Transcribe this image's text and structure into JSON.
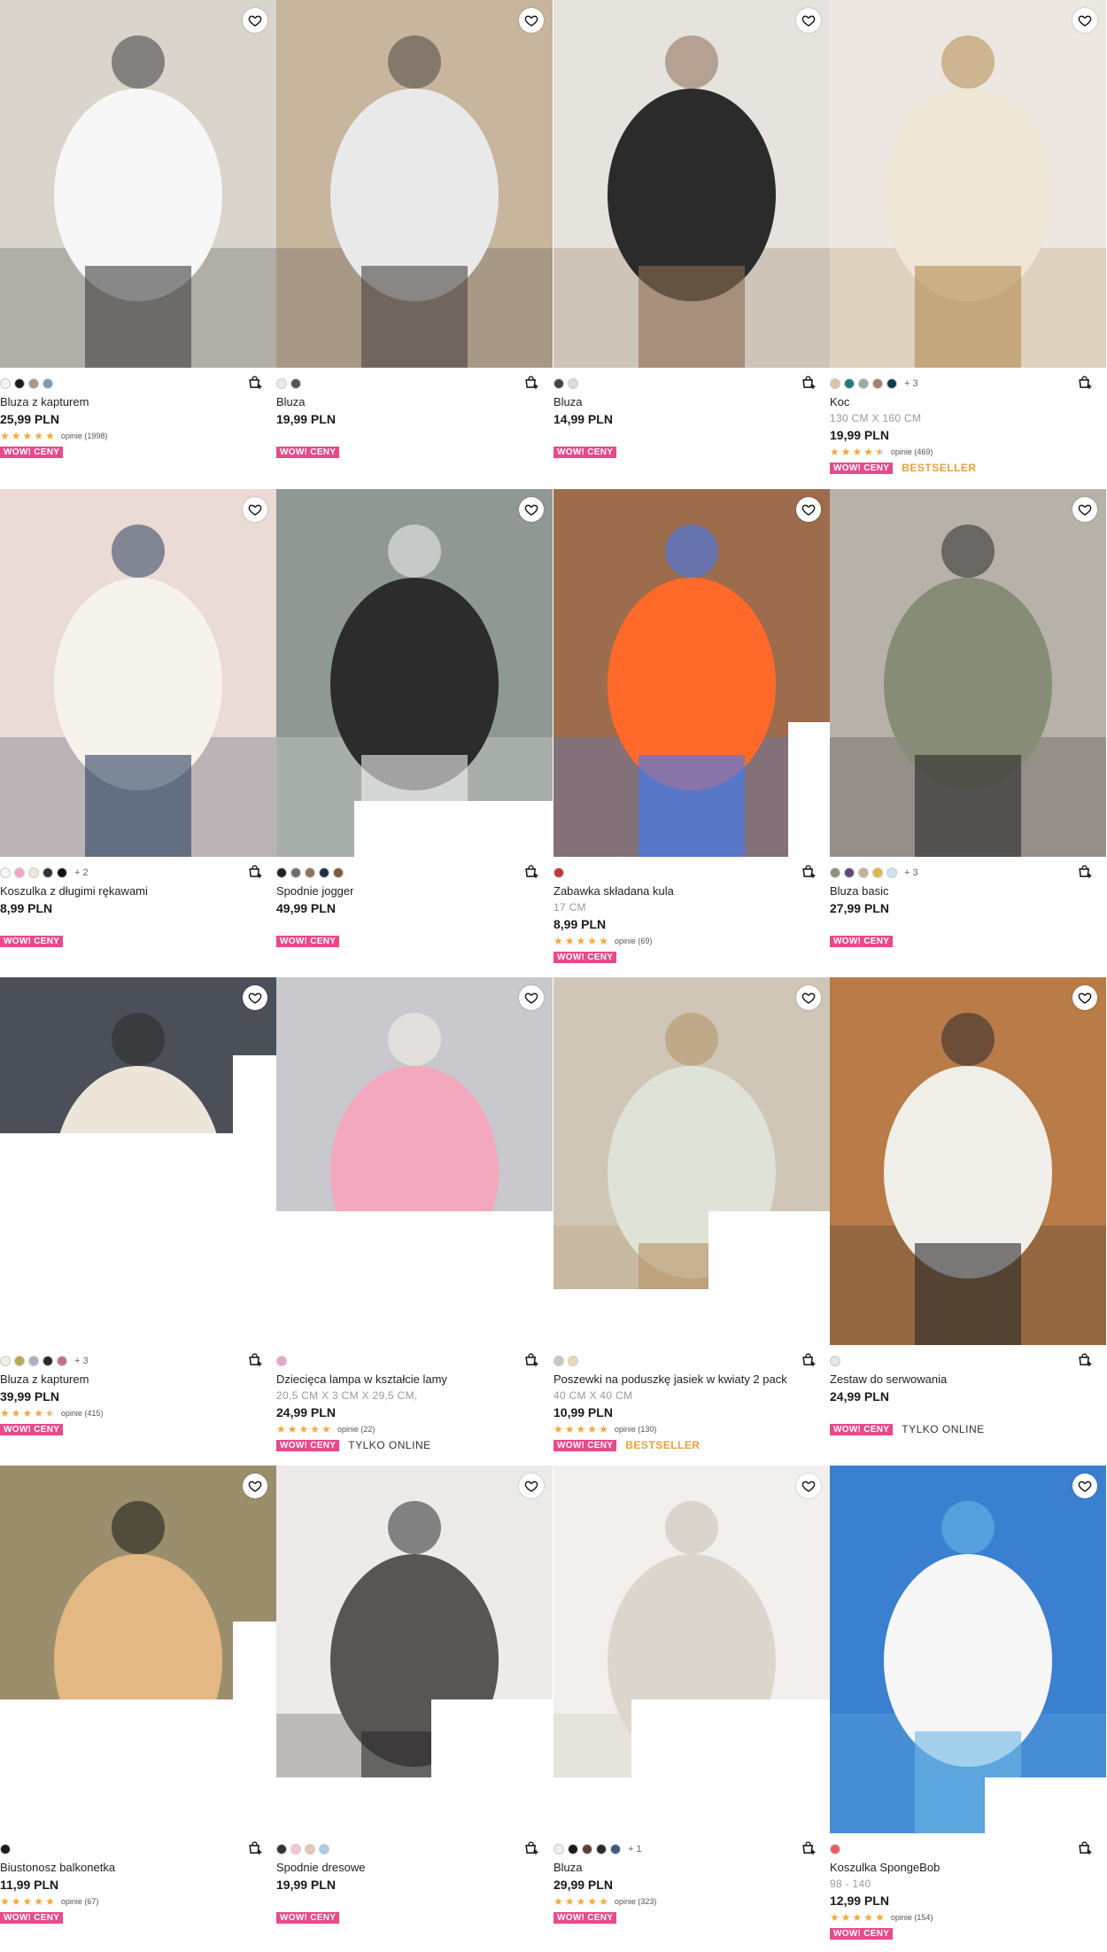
{
  "rows": [
    [
      {
        "name": "Bluza z kapturem",
        "sub": "",
        "price": "25,99 PLN",
        "rating": 5,
        "reviews": "opinie (1998)",
        "badges": [
          "WOW! CENY"
        ],
        "extra": "",
        "more": "",
        "swatches": [
          "#f4f4f4",
          "#1c1c1c",
          "#a8978a",
          "#7f9bb5"
        ],
        "img": {
          "bg": "#d9d4cc",
          "fg": "#f7f7f7",
          "accent": "#3d3d3d"
        }
      },
      {
        "name": "Bluza",
        "sub": "",
        "price": "19,99 PLN",
        "rating": 0,
        "reviews": "",
        "badges": [
          "WOW! CENY"
        ],
        "extra": "",
        "more": "",
        "swatches": [
          "#e8e8e8",
          "#555555"
        ],
        "img": {
          "bg": "#c7b59d",
          "fg": "#e9e9e9",
          "accent": "#4d4545"
        }
      },
      {
        "name": "Bluza",
        "sub": "",
        "price": "14,99 PLN",
        "rating": 0,
        "reviews": "",
        "badges": [
          "WOW! CENY"
        ],
        "extra": "",
        "more": "",
        "swatches": [
          "#444444",
          "#dddddd"
        ],
        "img": {
          "bg": "#e6e2dd",
          "fg": "#2b2b2b",
          "accent": "#8a6c52"
        }
      },
      {
        "name": "Koc",
        "sub": "130 CM X 160 CM",
        "price": "19,99 PLN",
        "rating": 4.5,
        "reviews": "opinie (469)",
        "badges": [
          "WOW! CENY"
        ],
        "extra": "BESTSELLER",
        "more": "+ 3",
        "swatches": [
          "#d9c7a8",
          "#1f7b7b",
          "#9aaba3",
          "#a77e6a",
          "#0f3a4f"
        ],
        "img": {
          "bg": "#ece8e1",
          "fg": "#efe6d6",
          "accent": "#b48a52"
        }
      }
    ],
    [
      {
        "name": "Koszulka z długimi rękawami",
        "sub": "",
        "price": "8,99 PLN",
        "rating": 0,
        "reviews": "",
        "badges": [
          "WOW! CENY"
        ],
        "extra": "",
        "more": "+ 2",
        "swatches": [
          "#f6f6f6",
          "#f2a6c8",
          "#ece6d6",
          "#333333",
          "#121212"
        ],
        "img": {
          "bg": "#eadbd5",
          "fg": "#f6f3ec",
          "accent": "#2b3f5f"
        }
      },
      {
        "name": "Spodnie jogger",
        "sub": "",
        "price": "49,99 PLN",
        "rating": 0,
        "reviews": "",
        "badges": [
          "WOW! CENY"
        ],
        "extra": "",
        "more": "",
        "swatches": [
          "#222222",
          "#6d6d6d",
          "#8b7459",
          "#1f2e48",
          "#7a5c3c"
        ],
        "img": {
          "bg": "#8f9892",
          "fg": "#2c2c2c",
          "accent": "#f2f2f2"
        }
      },
      {
        "name": "Zabawka składana kula",
        "sub": "17 CM",
        "price": "8,99 PLN",
        "rating": 5,
        "reviews": "opinie (69)",
        "badges": [
          "WOW! CENY"
        ],
        "extra": "",
        "more": "",
        "swatches": [
          "#c0393b"
        ],
        "img": {
          "bg": "#9d6c4c",
          "fg": "#ff6a2a",
          "accent": "#3a7bff"
        }
      },
      {
        "name": "Bluza basic",
        "sub": "",
        "price": "27,99 PLN",
        "rating": 0,
        "reviews": "",
        "badges": [
          "WOW! CENY"
        ],
        "extra": "",
        "more": "+ 3",
        "swatches": [
          "#8e9080",
          "#5b4a78",
          "#c5b09a",
          "#e0b845",
          "#cfe2ef"
        ],
        "img": {
          "bg": "#b7b2a8",
          "fg": "#878c77",
          "accent": "#2a2a2a"
        }
      }
    ],
    [
      {
        "name": "Bluza z kapturem",
        "sub": "",
        "price": "39,99 PLN",
        "rating": 4.5,
        "reviews": "opinie (415)",
        "badges": [
          "WOW! CENY"
        ],
        "extra": "",
        "more": "+ 3",
        "swatches": [
          "#f3eee2",
          "#b9a94a",
          "#a9b1bb",
          "#2a2a2a",
          "#c7707d"
        ],
        "img": {
          "bg": "#4a4f58",
          "fg": "#ece5d8",
          "accent": "#2b2b2b"
        }
      },
      {
        "name": "Dziecięca lampa w kształcie lamy",
        "sub": "20,5 CM X 3 CM X 29,5 CM,",
        "price": "24,99 PLN",
        "rating": 5,
        "reviews": "opinie (22)",
        "badges": [
          "WOW! CENY"
        ],
        "extra": "TYLKO ONLINE",
        "more": "",
        "swatches": [
          "#e9a6cc"
        ],
        "img": {
          "bg": "#c9c8cc",
          "fg": "#f4a8bd",
          "accent": "#f5f2ea"
        }
      },
      {
        "name": "Poszewki na poduszkę jasiek w kwiaty 2 pack",
        "sub": "40 CM X 40 CM",
        "price": "10,99 PLN",
        "rating": 5,
        "reviews": "opinie (130)",
        "badges": [
          "WOW! CENY"
        ],
        "extra": "BESTSELLER",
        "more": "",
        "swatches": [
          "#c8c9b8",
          "#efd8b8"
        ],
        "img": {
          "bg": "#cfc6b7",
          "fg": "#dfe2d6",
          "accent": "#b59263"
        }
      },
      {
        "name": "Zestaw do serwowania",
        "sub": "",
        "price": "24,99 PLN",
        "rating": 0,
        "reviews": "",
        "badges": [
          "WOW! CENY"
        ],
        "extra": "TYLKO ONLINE",
        "more": "",
        "swatches": [
          "#e3e8e6"
        ],
        "img": {
          "bg": "#b97b47",
          "fg": "#f0eee8",
          "accent": "#2a2a2a"
        }
      }
    ],
    [
      {
        "name": "Biustonosz balkonetka",
        "sub": "",
        "price": "11,99 PLN",
        "rating": 5,
        "reviews": "opinie (67)",
        "badges": [
          "WOW! CENY"
        ],
        "extra": "",
        "more": "",
        "swatches": [
          "#1a1a1a"
        ],
        "img": {
          "bg": "#9b8e6c",
          "fg": "#e3b884",
          "accent": "#151515"
        }
      },
      {
        "name": "Spodnie dresowe",
        "sub": "",
        "price": "19,99 PLN",
        "rating": 0,
        "reviews": "",
        "badges": [
          "WOW! CENY"
        ],
        "extra": "",
        "more": "",
        "swatches": [
          "#333333",
          "#f6c4d8",
          "#e8c7ac",
          "#a9cbe6"
        ],
        "img": {
          "bg": "#ecebea",
          "fg": "#5a5555",
          "accent": "#2a2a2a"
        }
      },
      {
        "name": "Bluza",
        "sub": "",
        "price": "29,99 PLN",
        "rating": 5,
        "reviews": "opinie (323)",
        "badges": [
          "WOW! CENY"
        ],
        "extra": "",
        "more": "+ 1",
        "swatches": [
          "#efefef",
          "#1a1a1a",
          "#5a4032",
          "#2a2a2a",
          "#3a5d7d"
        ],
        "img": {
          "bg": "#f2f0ed",
          "fg": "#ddd6cc",
          "accent": "#c5bdb1"
        }
      },
      {
        "name": "Koszulka SpongeBob",
        "sub": "98 - 140",
        "price": "12,99 PLN",
        "rating": 5,
        "reviews": "opinie (154)",
        "badges": [
          "WOW! CENY"
        ],
        "extra": "",
        "more": "",
        "swatches": [
          "#e85a6a"
        ],
        "img": {
          "bg": "#3b7fd0",
          "fg": "#f6f6f6",
          "accent": "#6db8e6"
        }
      }
    ]
  ]
}
